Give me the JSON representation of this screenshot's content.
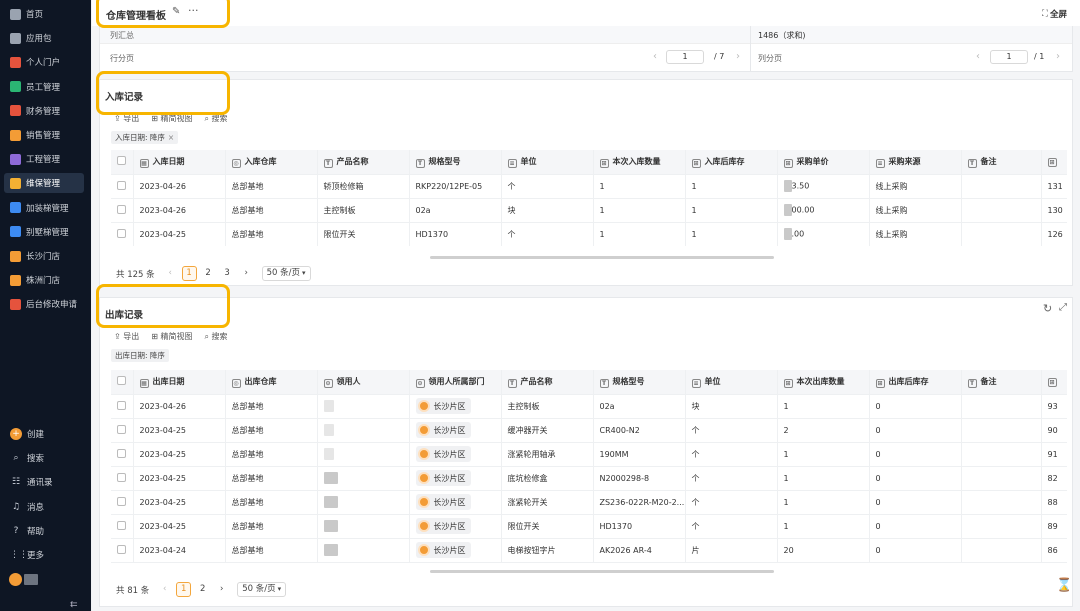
{
  "sidebar": {
    "items": [
      {
        "label": "首页",
        "color": "#9aa3b0"
      },
      {
        "label": "应用包",
        "color": "#9aa3b0"
      },
      {
        "label": "个人门户",
        "color": "#e5533d"
      },
      {
        "label": "员工管理",
        "color": "#2bb673"
      },
      {
        "label": "财务管理",
        "color": "#e5533d"
      },
      {
        "label": "销售管理",
        "color": "#f39c36"
      },
      {
        "label": "工程管理",
        "color": "#8e6ad8"
      },
      {
        "label": "维保管理",
        "color": "#f3b033"
      },
      {
        "label": "加装梯管理",
        "color": "#3d8bf2"
      },
      {
        "label": "别墅梯管理",
        "color": "#3d8bf2"
      },
      {
        "label": "长沙门店",
        "color": "#f39c36"
      },
      {
        "label": "株洲门店",
        "color": "#f39c36"
      },
      {
        "label": "后台修改申请",
        "color": "#e5533d"
      }
    ],
    "active_index": 7,
    "bottom": [
      {
        "label": "创建",
        "icon": "plus-circle-icon",
        "glyph": "+"
      },
      {
        "label": "搜索",
        "icon": "search-icon",
        "glyph": "⌕"
      },
      {
        "label": "通讯录",
        "icon": "contacts-icon",
        "glyph": "☷"
      },
      {
        "label": "消息",
        "icon": "bell-icon",
        "glyph": "♫"
      },
      {
        "label": "帮助",
        "icon": "help-icon",
        "glyph": "?"
      },
      {
        "label": "更多",
        "icon": "grid-icon",
        "glyph": "⋮⋮"
      }
    ],
    "collapse_glyph": "⇇"
  },
  "header": {
    "title": "仓库管理看板",
    "edit_glyph": "✎",
    "more_glyph": "···",
    "fullscreen_label": "全屏",
    "fullscreen_glyph": "⛶"
  },
  "summary": {
    "row1_label": "列汇总",
    "row1_right": "1486（求和)",
    "row2_left_label": "行分页",
    "row2_right_label": "列分页",
    "left_page": "1",
    "left_total": "/ 7",
    "right_page": "1",
    "right_total": "/ 1",
    "prev": "‹",
    "next": "›"
  },
  "inbound": {
    "title": "入库记录",
    "toolbar": {
      "export": "导出",
      "view": "精简视图",
      "search": "搜索"
    },
    "filter": "入库日期: 降序",
    "filter_close": "×",
    "columns": [
      "入库日期",
      "入库仓库",
      "产品名称",
      "规格型号",
      "单位",
      "本次入库数量",
      "入库后库存",
      "采购单价",
      "采购来源",
      "备注",
      ""
    ],
    "col_icons": [
      "▦",
      "◎",
      "T",
      "T",
      "≡",
      "⊞",
      "⊞",
      "⊞",
      "≡",
      "T",
      "⊞"
    ],
    "rows": [
      [
        "2023-04-26",
        "总部基地",
        "轿顶检修箱",
        "RKP220/12PE-05",
        "个",
        "1",
        "1",
        "3.50",
        "线上采购",
        "",
        "131"
      ],
      [
        "2023-04-26",
        "总部基地",
        "主控制板",
        "02a",
        "块",
        "1",
        "1",
        "00.00",
        "线上采购",
        "",
        "130"
      ],
      [
        "2023-04-25",
        "总部基地",
        "限位开关",
        "HD1370",
        "个",
        "1",
        "1",
        ".00",
        "线上采购",
        "",
        "126"
      ]
    ],
    "pagination": {
      "total": "共 125 条",
      "pages": [
        "1",
        "2",
        "3"
      ],
      "current": "1",
      "page_size": "50 条/页"
    }
  },
  "outbound": {
    "title": "出库记录",
    "toolbar": {
      "export": "导出",
      "view": "精简视图",
      "search": "搜索"
    },
    "filter": "出库日期: 降序",
    "columns": [
      "出库日期",
      "出库仓库",
      "领用人",
      "领用人所属部门",
      "产品名称",
      "规格型号",
      "单位",
      "本次出库数量",
      "出库后库存",
      "备注",
      ""
    ],
    "col_icons": [
      "▦",
      "◎",
      "⊙",
      "⊙",
      "T",
      "T",
      "≡",
      "⊞",
      "⊞",
      "T",
      "⊞"
    ],
    "rows": [
      [
        "2023-04-26",
        "总部基地",
        "",
        "长沙片区",
        "主控制板",
        "02a",
        "块",
        "1",
        "0",
        "",
        "93"
      ],
      [
        "2023-04-25",
        "总部基地",
        "",
        "长沙片区",
        "缓冲器开关",
        "CR400-N2",
        "个",
        "2",
        "0",
        "",
        "90"
      ],
      [
        "2023-04-25",
        "总部基地",
        "",
        "长沙片区",
        "涨紧轮用轴承",
        "190MM",
        "个",
        "1",
        "0",
        "",
        "91"
      ],
      [
        "2023-04-25",
        "总部基地",
        "",
        "长沙片区",
        "底坑检修盒",
        "N2000298-8",
        "个",
        "1",
        "0",
        "",
        "82"
      ],
      [
        "2023-04-25",
        "总部基地",
        "",
        "长沙片区",
        "涨紧轮开关",
        "ZS236-022R-M20-2...",
        "个",
        "1",
        "0",
        "",
        "88"
      ],
      [
        "2023-04-25",
        "总部基地",
        "",
        "长沙片区",
        "限位开关",
        "HD1370",
        "个",
        "1",
        "0",
        "",
        "89"
      ],
      [
        "2023-04-24",
        "总部基地",
        "",
        "长沙片区",
        "电梯按钮字片",
        "AK2026 AR-4",
        "片",
        "20",
        "0",
        "",
        "86"
      ]
    ],
    "pagination": {
      "total": "共 81 条",
      "pages": [
        "1",
        "2"
      ],
      "current": "1",
      "page_size": "50 条/页"
    }
  }
}
